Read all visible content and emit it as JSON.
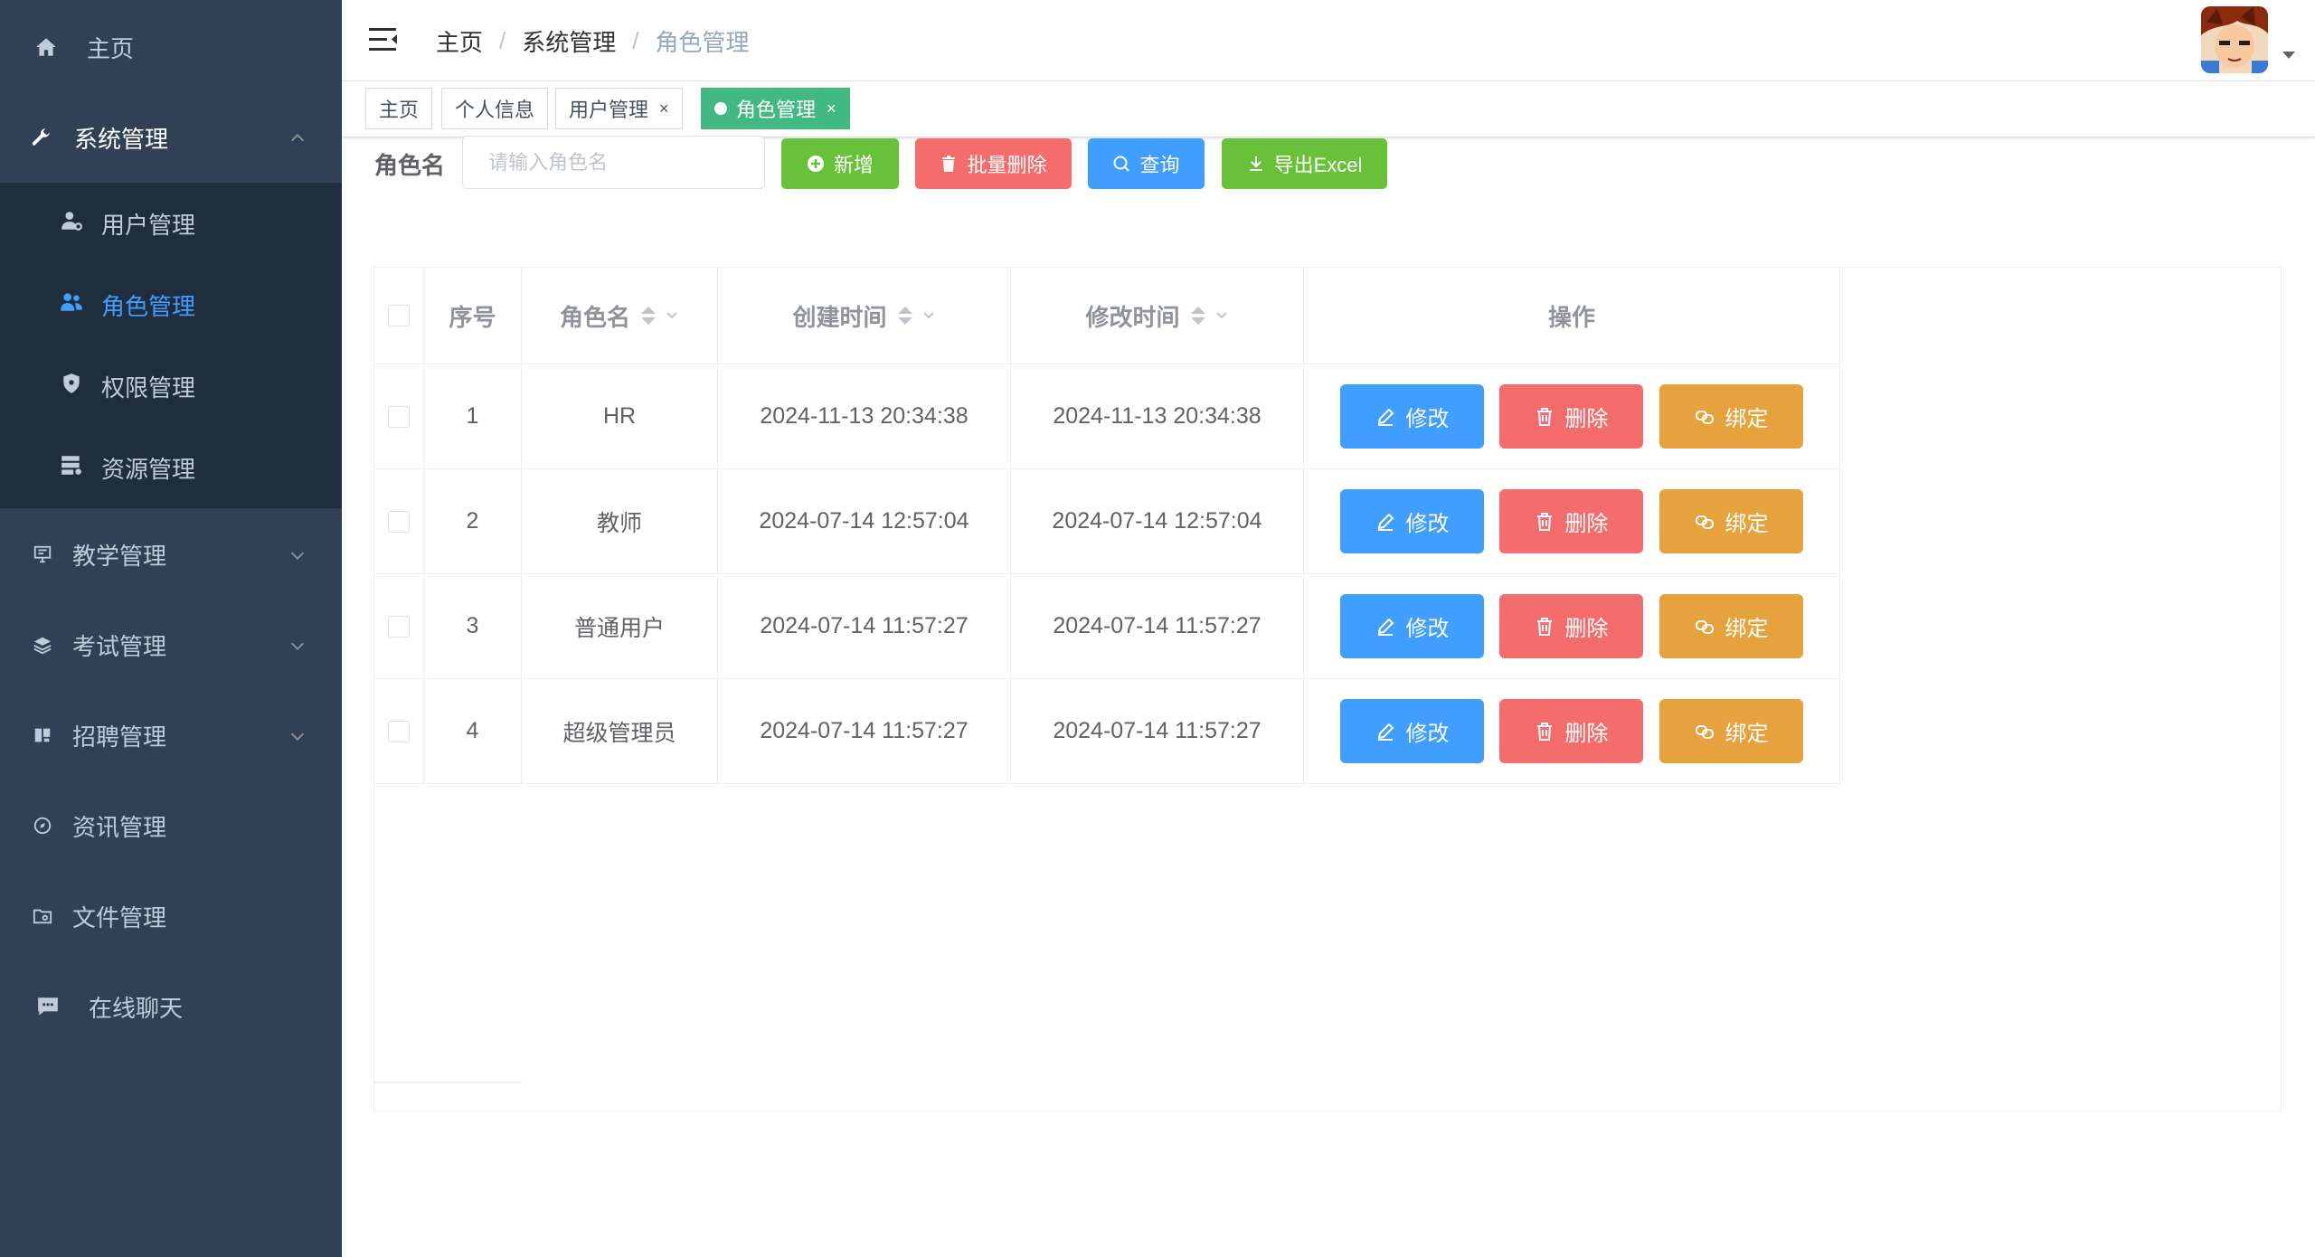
{
  "sidebar": {
    "home": "主页",
    "system": "系统管理",
    "sub_items": [
      "用户管理",
      "角色管理",
      "权限管理",
      "资源管理"
    ],
    "groups": [
      "教学管理",
      "考试管理",
      "招聘管理",
      "资讯管理",
      "文件管理"
    ],
    "chat": "在线聊天"
  },
  "header": {
    "breadcrumb": [
      "主页",
      "系统管理",
      "角色管理"
    ],
    "separator": "/"
  },
  "tags": [
    {
      "label": "主页"
    },
    {
      "label": "个人信息"
    },
    {
      "label": "用户管理",
      "close": "×"
    },
    {
      "label": "角色管理",
      "close": "×",
      "active": true
    }
  ],
  "toolbar": {
    "filter_label": "角色名",
    "filter_placeholder": "请输入角色名",
    "add": "新增",
    "batch_delete": "批量删除",
    "search": "查询",
    "export": "导出Excel"
  },
  "table": {
    "columns": [
      "序号",
      "角色名",
      "创建时间",
      "修改时间",
      "操作"
    ],
    "rows": [
      {
        "index": "1",
        "name": "HR",
        "created": "2024-11-13 20:34:38",
        "updated": "2024-11-13 20:34:38"
      },
      {
        "index": "2",
        "name": "教师",
        "created": "2024-07-14 12:57:04",
        "updated": "2024-07-14 12:57:04"
      },
      {
        "index": "3",
        "name": "普通用户",
        "created": "2024-07-14 11:57:27",
        "updated": "2024-07-14 11:57:27"
      },
      {
        "index": "4",
        "name": "超级管理员",
        "created": "2024-07-14 11:57:27",
        "updated": "2024-07-14 11:57:27"
      }
    ],
    "actions": {
      "edit": "修改",
      "delete": "删除",
      "bind": "绑定"
    }
  },
  "colors": {
    "sidebar_bg": "#304156",
    "submenu_bg": "#1f2d3d",
    "active_menu": "#409eff",
    "active_tag": "#42b983",
    "primary": "#409eff",
    "success": "#67c23a",
    "danger": "#f56c6c",
    "warning": "#e6a23c"
  }
}
